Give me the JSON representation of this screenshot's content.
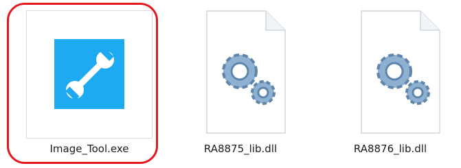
{
  "files": [
    {
      "name": "Image_Tool.exe",
      "selected": true,
      "icon": "wrench-app-icon"
    },
    {
      "name": "RA8875_lib.dll",
      "selected": false,
      "icon": "gear-dll-icon"
    },
    {
      "name": "RA8876_lib.dll",
      "selected": false,
      "icon": "gear-dll-icon"
    }
  ],
  "colors": {
    "selection": "#e0191e",
    "exe_tile": "#1eaaf1",
    "gear": "#7b9fc2"
  }
}
